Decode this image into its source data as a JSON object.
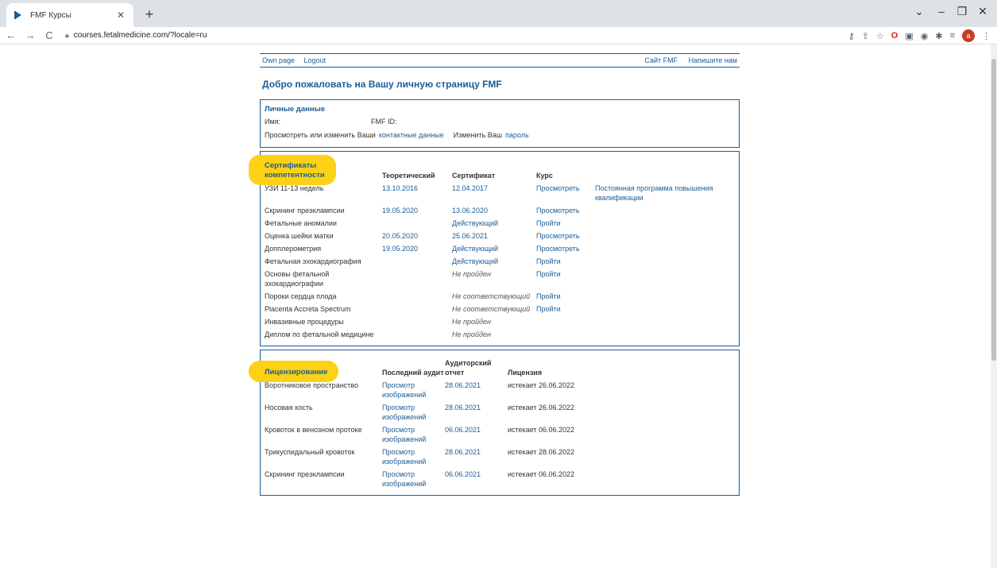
{
  "browser": {
    "tab_title": "FMF Курсы",
    "url": "courses.fetalmedicine.com/?locale=ru"
  },
  "topnav": {
    "own_page": "Own page",
    "logout": "Logout",
    "fmf_site": "Сайт FMF",
    "write_us": "Напишите нам"
  },
  "welcome": "Добро пожаловать на Вашу личную страницу FMF",
  "personal": {
    "title": "Личные данные",
    "name_label": "Имя:",
    "fmf_id_label": "FMF ID:",
    "view_text": "Просмотреть или изменить Ваши",
    "contact_link": "контактные данные",
    "change_text": "Изменить Ваш",
    "password_link": "пароль"
  },
  "certificates": {
    "title_line1": "Сертификаты",
    "title_line2": "компетентности",
    "headers": [
      "Теоретический",
      "Сертификат",
      "Курс"
    ],
    "rows": [
      {
        "name": "УЗИ 11-13 недель",
        "theory": "13.10.2016",
        "cert": "12.04.2017",
        "course": "Просмотреть",
        "extra": "Постоянная программа повышения квалификации"
      },
      {
        "name": "Скрининг преэклампсии",
        "theory": "19.05.2020",
        "cert": "13.06.2020",
        "course": "Просмотреть",
        "extra": ""
      },
      {
        "name": "Фетальные аномалии",
        "theory": "",
        "cert": "Действующий",
        "course": "Пройти",
        "extra": ""
      },
      {
        "name": "Оценка шейки матки",
        "theory": "20.05.2020",
        "cert": "25.06.2021",
        "course": "Просмотреть",
        "extra": ""
      },
      {
        "name": "Допплерометрия",
        "theory": "19.05.2020",
        "cert": "Действующий",
        "course": "Просмотреть",
        "extra": ""
      },
      {
        "name": "Фетальная эхокардиография",
        "theory": "",
        "cert": "Действующий",
        "course": "Пройти",
        "extra": ""
      },
      {
        "name": "Основы фетальной эхокардиографии",
        "theory": "",
        "cert": "Не пройден",
        "course": "Пройти",
        "extra": ""
      },
      {
        "name": "Пороки сердца плода",
        "theory": "",
        "cert": "Не соответствующий",
        "course": "Пройти",
        "extra": ""
      },
      {
        "name": "Placenta Accreta Spectrum",
        "theory": "",
        "cert": "Не соответствующий",
        "course": "Пройти",
        "extra": ""
      },
      {
        "name": "Инвазивные процедуры",
        "theory": "",
        "cert": "Не пройден",
        "course": "",
        "extra": ""
      },
      {
        "name": "Диплом по фетальной медицине",
        "theory": "",
        "cert": "Не пройден",
        "course": "",
        "extra": ""
      }
    ]
  },
  "licensing": {
    "title": "Лицензирование",
    "headers": [
      "Последний аудит",
      "Аудиторский отчет",
      "Лицензия"
    ],
    "rows": [
      {
        "name": "Воротниковое пространство",
        "audit": "Просмотр изображений",
        "report": "28.06.2021",
        "license": "истекает 26.06.2022"
      },
      {
        "name": "Носовая кость",
        "audit": "Просмотр изображений",
        "report": "28.06.2021",
        "license": "истекает 26.06.2022"
      },
      {
        "name": "Кровоток в венозном протоке",
        "audit": "Просмотр изображений",
        "report": "06.06.2021",
        "license": "истекает 06.06.2022"
      },
      {
        "name": "Трикуспидальный кровоток",
        "audit": "Просмотр изображений",
        "report": "28.06.2021",
        "license": "истекает 28.06.2022"
      },
      {
        "name": "Скрининг преэклампсии",
        "audit": "Просмотр изображений",
        "report": "06.06.2021",
        "license": "истекает 06.06.2022"
      }
    ]
  }
}
